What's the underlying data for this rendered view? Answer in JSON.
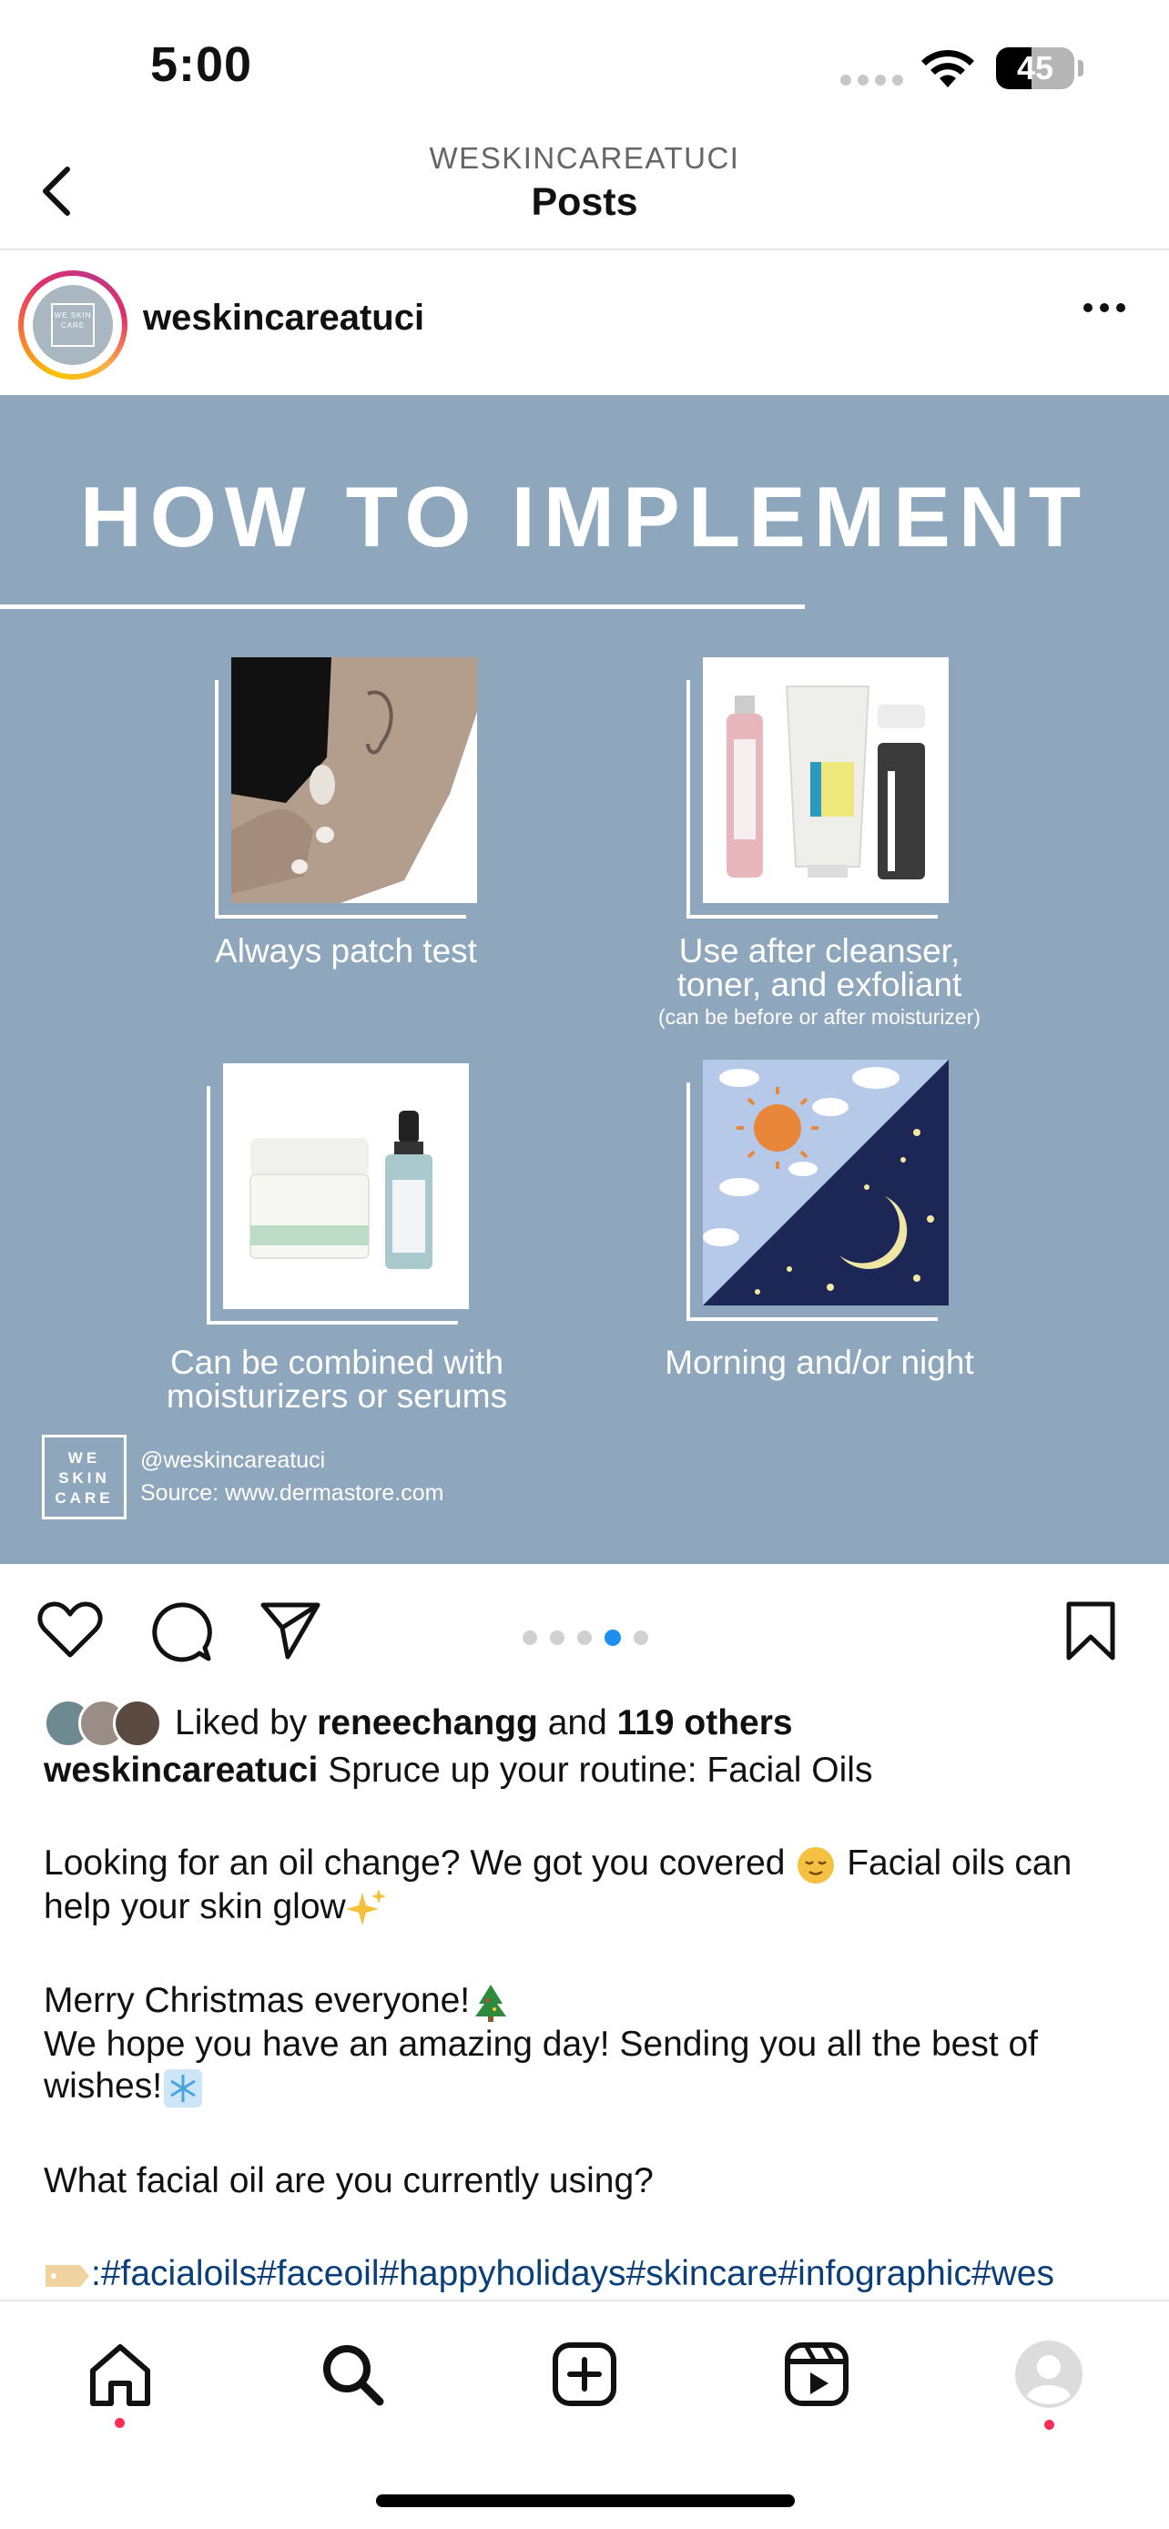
{
  "status_bar": {
    "time": "5:00",
    "battery": "45",
    "battery_level": 0.45
  },
  "header": {
    "account": "WESKINCAREATUCI",
    "title": "Posts",
    "back_icon": "chevron-left-icon"
  },
  "post": {
    "username": "weskincareatuci",
    "avatar_text": "WE SKIN CARE",
    "more_icon": "ellipsis-icon",
    "image": {
      "title": "HOW TO IMPLEMENT",
      "panels": [
        {
          "caption": "Always patch test",
          "note": ""
        },
        {
          "caption": "Use after cleanser,\ntoner, and exfoliant",
          "note": "(can be before or after moisturizer)"
        },
        {
          "caption": "Can be combined with\nmoisturizers or serums",
          "note": ""
        },
        {
          "caption": "Morning and/or night",
          "note": ""
        }
      ],
      "brand_logo": "WE SKIN CARE",
      "handle": "@weskincareatuci",
      "source": "Source: www.dermastore.com",
      "background": "#8fa7bc"
    },
    "carousel": {
      "count": 5,
      "active_index": 3
    },
    "likes": {
      "prefix": "Liked by",
      "user": "reneechangg",
      "middle": "and",
      "others": "119 others"
    },
    "caption": {
      "username": "weskincareatuci",
      "headline": "Spruce up your routine: Facial Oils",
      "p1_text": "Looking for an oil change? We got you covered",
      "p1_emoji": "relieved-face",
      "p1_text2": "Facial oils can help your skin glow",
      "p1_emoji2": "sparkles",
      "p2_line1": "Merry Christmas everyone!",
      "p2_emoji1": "christmas-tree",
      "p2_line2": "We hope you have an amazing day! Sending you all the best of wishes!",
      "p2_emoji2": "snowflake",
      "question": "What facial oil are you currently using?",
      "tag_emoji": "label-tag",
      "hashtags": ":#facialoils#faceoil#happyholidays#skincare#infographic#wes"
    }
  },
  "tab_bar": {
    "items": [
      "home",
      "search",
      "create",
      "reels",
      "profile"
    ]
  },
  "colors": {
    "accent_blue": "#1f8ef1",
    "notification_red": "#ff2d55",
    "hashtag": "#0b3f7a"
  }
}
